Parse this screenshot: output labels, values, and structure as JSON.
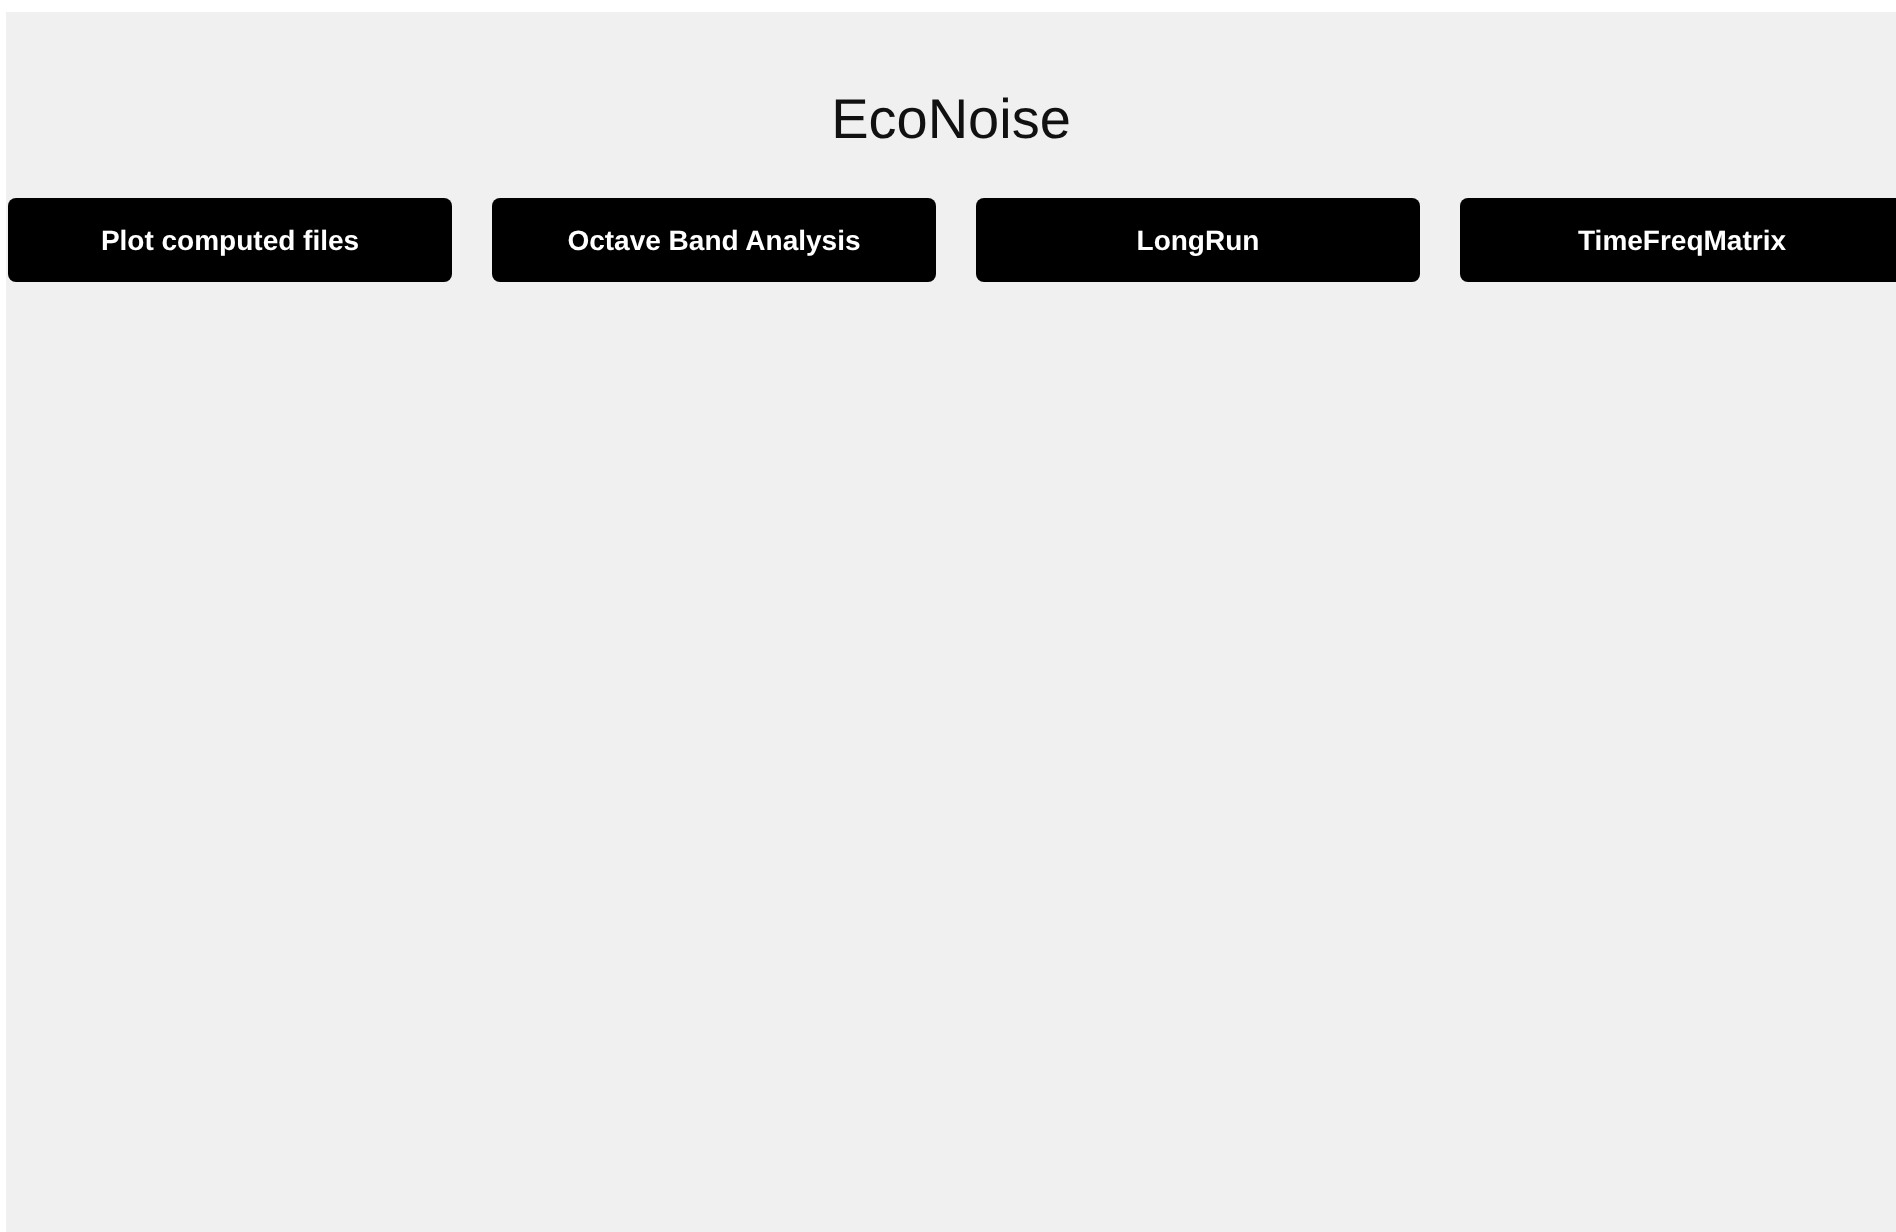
{
  "title": "EcoNoise",
  "buttons": [
    {
      "label": "Plot computed files"
    },
    {
      "label": "Octave Band Analysis"
    },
    {
      "label": "LongRun"
    },
    {
      "label": "TimeFreqMatrix"
    }
  ]
}
